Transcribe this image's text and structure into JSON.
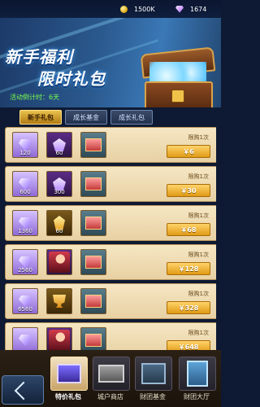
{
  "currency": {
    "coins": "1500K",
    "gems": "1674"
  },
  "banner": {
    "title_line1": "新手福利",
    "title_line2": "限时礼包",
    "countdown_label": "活动倒计时：",
    "countdown_value": "6天"
  },
  "tabs": [
    {
      "label": "新手礼包",
      "active": true
    },
    {
      "label": "成长基金",
      "active": false
    },
    {
      "label": "成长礼包",
      "active": false
    }
  ],
  "offers": [
    {
      "items": [
        {
          "icon": "diamond",
          "qty": "120"
        },
        {
          "icon": "purple-badge",
          "qty": "60"
        },
        {
          "icon": "gift-box",
          "qty": ""
        }
      ],
      "limit": "限购1次",
      "price": "￥6"
    },
    {
      "items": [
        {
          "icon": "diamond",
          "qty": "600"
        },
        {
          "icon": "purple-badge",
          "qty": "300"
        },
        {
          "icon": "gift-box",
          "qty": ""
        }
      ],
      "limit": "限购1次",
      "price": "￥30"
    },
    {
      "items": [
        {
          "icon": "diamond",
          "qty": "1360"
        },
        {
          "icon": "topaz",
          "qty": "60"
        },
        {
          "icon": "gift-box",
          "qty": ""
        }
      ],
      "limit": "限购1次",
      "price": "￥68"
    },
    {
      "items": [
        {
          "icon": "diamond",
          "qty": "2560"
        },
        {
          "icon": "hero-portrait",
          "qty": ""
        },
        {
          "icon": "gift-box",
          "qty": ""
        }
      ],
      "limit": "限购1次",
      "price": "￥128"
    },
    {
      "items": [
        {
          "icon": "diamond",
          "qty": "6560"
        },
        {
          "icon": "trophy",
          "qty": ""
        },
        {
          "icon": "gift-box",
          "qty": ""
        }
      ],
      "limit": "限购1次",
      "price": "￥328"
    },
    {
      "items": [
        {
          "icon": "diamond",
          "qty": ""
        },
        {
          "icon": "hero-portrait",
          "qty": ""
        },
        {
          "icon": "gift-box",
          "qty": ""
        }
      ],
      "limit": "限购1次",
      "price": "￥648"
    }
  ],
  "bottom_nav": [
    {
      "label": "特价礼包",
      "active": true
    },
    {
      "label": "城户商店",
      "active": false
    },
    {
      "label": "财团基金",
      "active": false
    },
    {
      "label": "财团大厅",
      "active": false
    }
  ]
}
